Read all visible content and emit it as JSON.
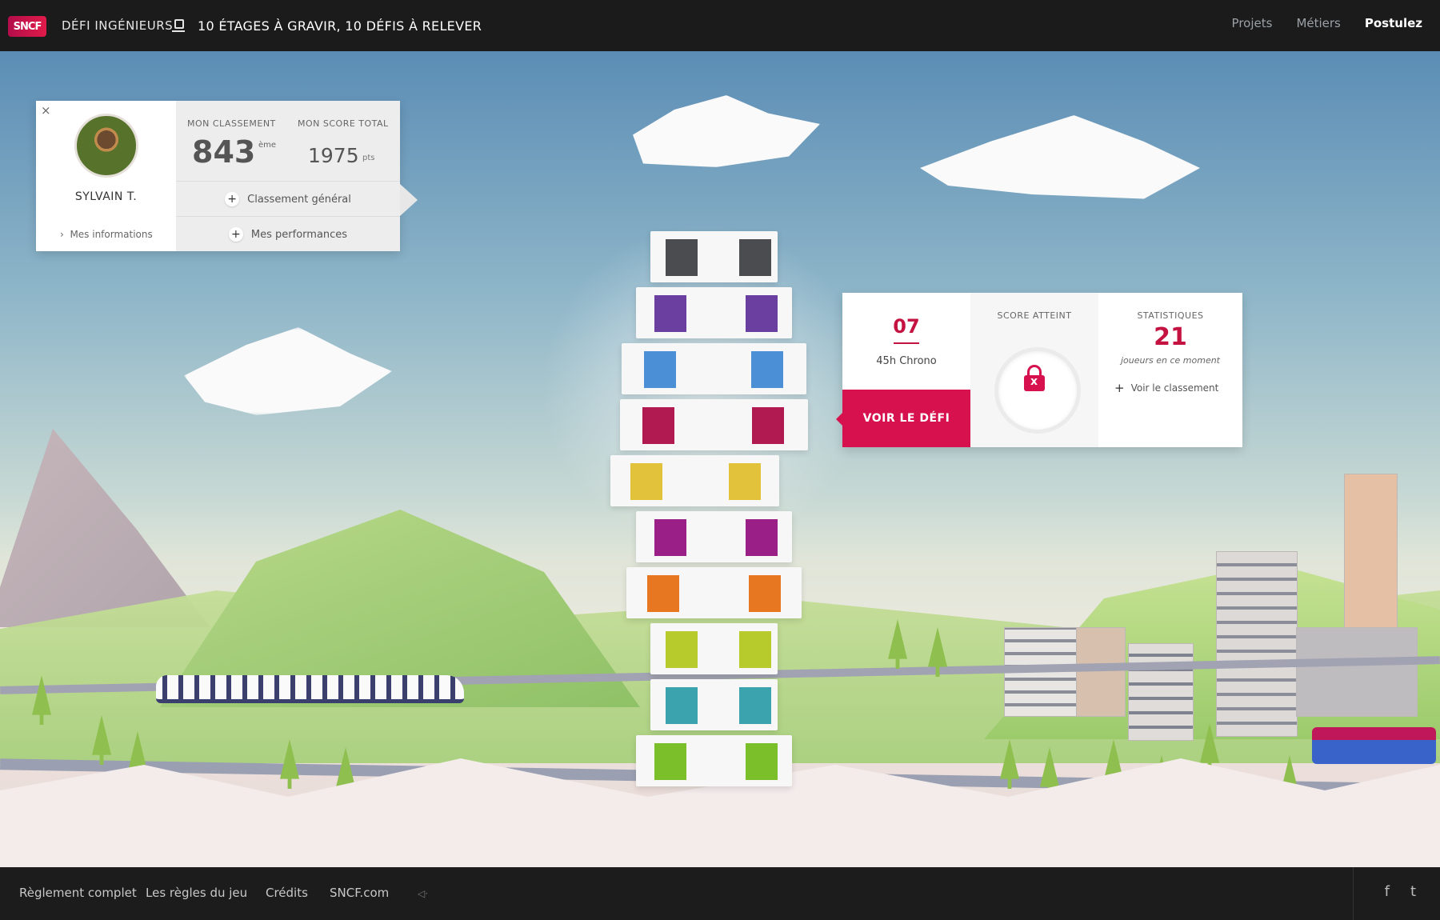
{
  "header": {
    "logo": "SNCF",
    "title": "DÉFI INGÉNIEURS",
    "tagline": "10 ÉTAGES À GRAVIR, 10 DÉFIS À RELEVER",
    "nav": [
      {
        "label": "Projets"
      },
      {
        "label": "Métiers"
      },
      {
        "label": "Postulez"
      }
    ]
  },
  "profile": {
    "close": "×",
    "name": "SYLVAIN T.",
    "my_info": "Mes informations",
    "rank_label": "MON CLASSEMENT",
    "rank_value": "843",
    "rank_unit": "ème",
    "score_label": "MON SCORE TOTAL",
    "score_value": "1975",
    "score_unit": "pts",
    "links": [
      {
        "label": "Classement général"
      },
      {
        "label": "Mes performances"
      }
    ]
  },
  "challenge": {
    "floor_number": "07",
    "floor_subtitle": "45h Chrono",
    "cta": "VOIR LE DÉFI",
    "score_label": "SCORE ATTEINT",
    "stats_label": "STATISTIQUES",
    "stats_value": "21",
    "stats_desc": "joueurs en ce moment",
    "stats_link": "Voir le classement"
  },
  "tower": {
    "floors": [
      {
        "color": "#4a4c4f"
      },
      {
        "color": "#6a3fa0"
      },
      {
        "color": "#4b8fd6"
      },
      {
        "color": "#b01a50"
      },
      {
        "color": "#e2c23a"
      },
      {
        "color": "#9a1f86"
      },
      {
        "color": "#e87722"
      },
      {
        "color": "#b7cc2c"
      },
      {
        "color": "#3aa3ae"
      },
      {
        "color": "#7bbf2b"
      }
    ]
  },
  "footer": {
    "links": [
      {
        "label": "Règlement complet"
      },
      {
        "label": "Les règles du jeu"
      },
      {
        "label": "Crédits"
      },
      {
        "label": "SNCF.com"
      }
    ],
    "sound_icon": "sound-icon",
    "social": [
      {
        "label": "f",
        "icon": "facebook-icon"
      },
      {
        "label": "t",
        "icon": "twitter-icon"
      }
    ]
  },
  "colors": {
    "accent": "#d6114e",
    "dark_bar": "#1b1b1c"
  }
}
